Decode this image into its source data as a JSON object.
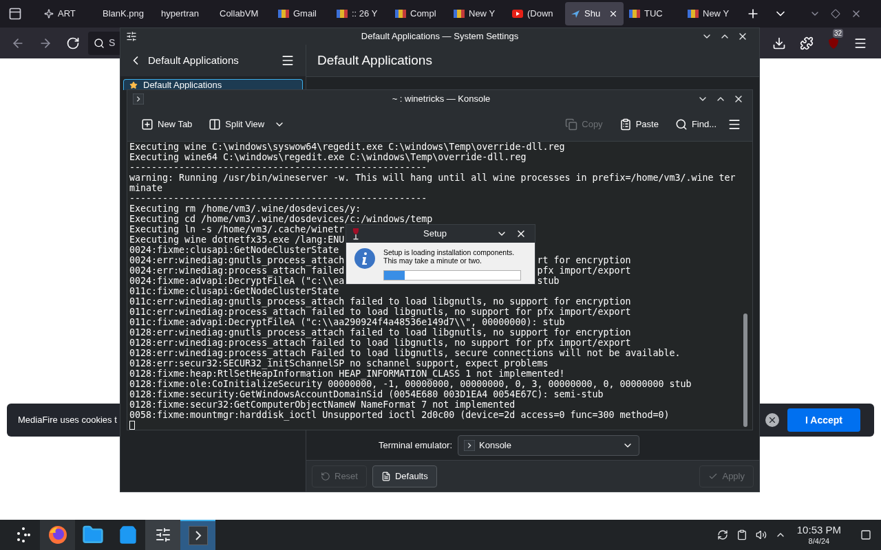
{
  "browser": {
    "tabs": [
      {
        "label": "ART",
        "selected": false
      },
      {
        "label": "BlanK.png",
        "selected": false
      },
      {
        "label": "hypertran",
        "selected": false
      },
      {
        "label": "CollabVM",
        "selected": false
      },
      {
        "label": "Gmail",
        "selected": false
      },
      {
        "label": ":: 26 Y",
        "selected": false
      },
      {
        "label": "Compl",
        "selected": false
      },
      {
        "label": "New Y",
        "selected": false
      },
      {
        "label": "(Down",
        "selected": false
      },
      {
        "label": "Shu",
        "selected": true
      },
      {
        "label": "TUC",
        "selected": false
      },
      {
        "label": "New Y",
        "selected": false
      }
    ],
    "search": {
      "placeholder": "S"
    },
    "extension_badge": "32",
    "cookie_banner": {
      "text": "MediaFire uses cookies t",
      "button": "I Accept"
    }
  },
  "settings_window": {
    "title": "Default Applications — System Settings",
    "sidebar_title": "Default Applications",
    "page_title": "Default Applications",
    "sidebar_items": [
      {
        "label": "Default Applications",
        "selected": true
      }
    ],
    "fields": [
      {
        "label": "Terminal emulator:",
        "value": "Konsole"
      }
    ],
    "buttons": [
      {
        "label": "Reset",
        "disabled": true
      },
      {
        "label": "Defaults",
        "disabled": false
      },
      {
        "label": "Apply",
        "disabled": true
      }
    ]
  },
  "konsole": {
    "title": "~ : winetricks — Konsole",
    "toolbar": [
      {
        "label": "New Tab",
        "disabled": false
      },
      {
        "label": "Split View",
        "disabled": false
      },
      {
        "label": "Copy",
        "disabled": true
      },
      {
        "label": "Paste",
        "disabled": false
      },
      {
        "label": "Find...",
        "disabled": false
      }
    ],
    "lines": [
      {
        "text": "Executing wine C:\\windows\\syswow64\\regedit.exe C:\\windows\\Temp\\override-dll.reg"
      },
      {
        "text": "Executing wine64 C:\\windows\\regedit.exe C:\\windows\\Temp\\override-dll.reg"
      },
      {
        "text": "------------------------------------------------------"
      },
      {
        "text": "warning: Running /usr/bin/wineserver -w. This will hang until all wine processes in prefix=/home/vm3/.wine ter"
      },
      {
        "text": "minate"
      },
      {
        "text": "------------------------------------------------------"
      },
      {
        "text": "Executing rm /home/vm3/.wine/dosdevices/y:"
      },
      {
        "text": "Executing cd /home/vm3/.wine/dosdevices/c:/windows/temp"
      },
      {
        "text": "Executing ln -s /home/vm3/.cache/winetr"
      },
      {
        "text": "Executing wine dotnetfx35.exe /lang:ENU"
      },
      {
        "text": "0024:fixme:clusapi:GetNodeClusterState"
      },
      {
        "text": "0024:err:winediag:gnutls_process_attach",
        "tail": "rt for encryption"
      },
      {
        "text": "0024:err:winediag:process_attach failed",
        "tail": "pfx import/export"
      },
      {
        "text": "0024:fixme:advapi:DecryptFileA (\"c:\\\\ea",
        "tail": "stub"
      },
      {
        "text": "011c:fixme:clusapi:GetNodeClusterState"
      },
      {
        "text": "011c:err:winediag:gnutls_process_attach failed to load libgnutls, no support for encryption"
      },
      {
        "text": "011c:err:winediag:process_attach failed to load libgnutls, no support for pfx import/export"
      },
      {
        "text": "011c:fixme:advapi:DecryptFileA (\"c:\\\\aa290924f4a48536e149d7\\\\\", 00000000): stub"
      },
      {
        "text": "0128:err:winediag:gnutls_process_attach failed to load libgnutls, no support for encryption"
      },
      {
        "text": "0128:err:winediag:process_attach failed to load libgnutls, no support for pfx import/export"
      },
      {
        "text": "0128:err:winediag:process_attach Failed to load libgnutls, secure connections will not be available."
      },
      {
        "text": "0128:err:secur32:SECUR32_initSchannelSP no schannel support, expect problems"
      },
      {
        "text": "0128:fixme:heap:RtlSetHeapInformation HEAP_INFORMATION_CLASS 1 not implemented!"
      },
      {
        "text": "0128:fixme:ole:CoInitializeSecurity 00000000, -1, 00000000, 00000000, 0, 3, 00000000, 0, 00000000 stub"
      },
      {
        "text": "0128:fixme:security:GetWindowsAccountDomainSid (0054E680 003D1EA4 0054E67C): semi-stub"
      },
      {
        "text": "0128:fixme:secur32:GetComputerObjectNameW NameFormat 7 not implemented"
      },
      {
        "text": "0058:fixme:mountmgr:harddisk_ioctl Unsupported ioctl 2d0c00 (device=2d access=0 func=300 method=0)"
      }
    ]
  },
  "setup_dialog": {
    "title": "Setup",
    "message": [
      "Setup is loading installation components.",
      "This may take a minute or two."
    ],
    "level": 0.15
  },
  "taskbar": {
    "tasks": [
      {
        "selected": false
      },
      {
        "selected": false
      },
      {
        "selected": false
      },
      {
        "selected": false
      },
      {
        "selected": true
      }
    ],
    "time": "10:53 PM",
    "date": "8/4/24"
  }
}
